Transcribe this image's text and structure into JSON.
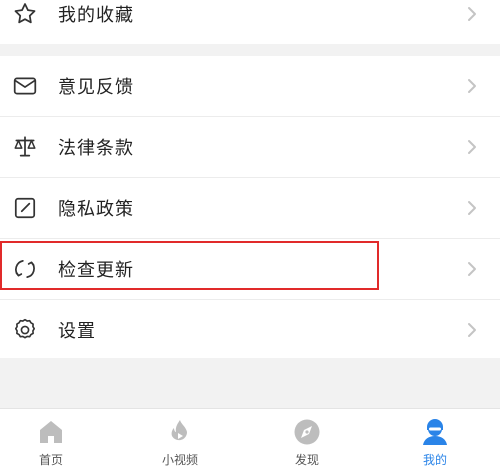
{
  "menu": {
    "favorites": "我的收藏",
    "feedback": "意见反馈",
    "legal": "法律条款",
    "privacy": "隐私政策",
    "update": "检查更新",
    "settings": "设置"
  },
  "icons": {
    "favorites": "star-icon",
    "feedback": "mail-icon",
    "legal": "scales-icon",
    "privacy": "edit-square-icon",
    "update": "refresh-icon",
    "settings": "gear-icon",
    "chevron": "chevron-right-icon"
  },
  "tabbar": {
    "home": "首页",
    "videos": "小视频",
    "discover": "发现",
    "mine": "我的",
    "active_tab": "mine"
  },
  "colors": {
    "active": "#2a84e8",
    "inactive_icon": "#bdbdbd",
    "highlight_border": "#e12a2a",
    "chevron": "#c4c4c4"
  }
}
